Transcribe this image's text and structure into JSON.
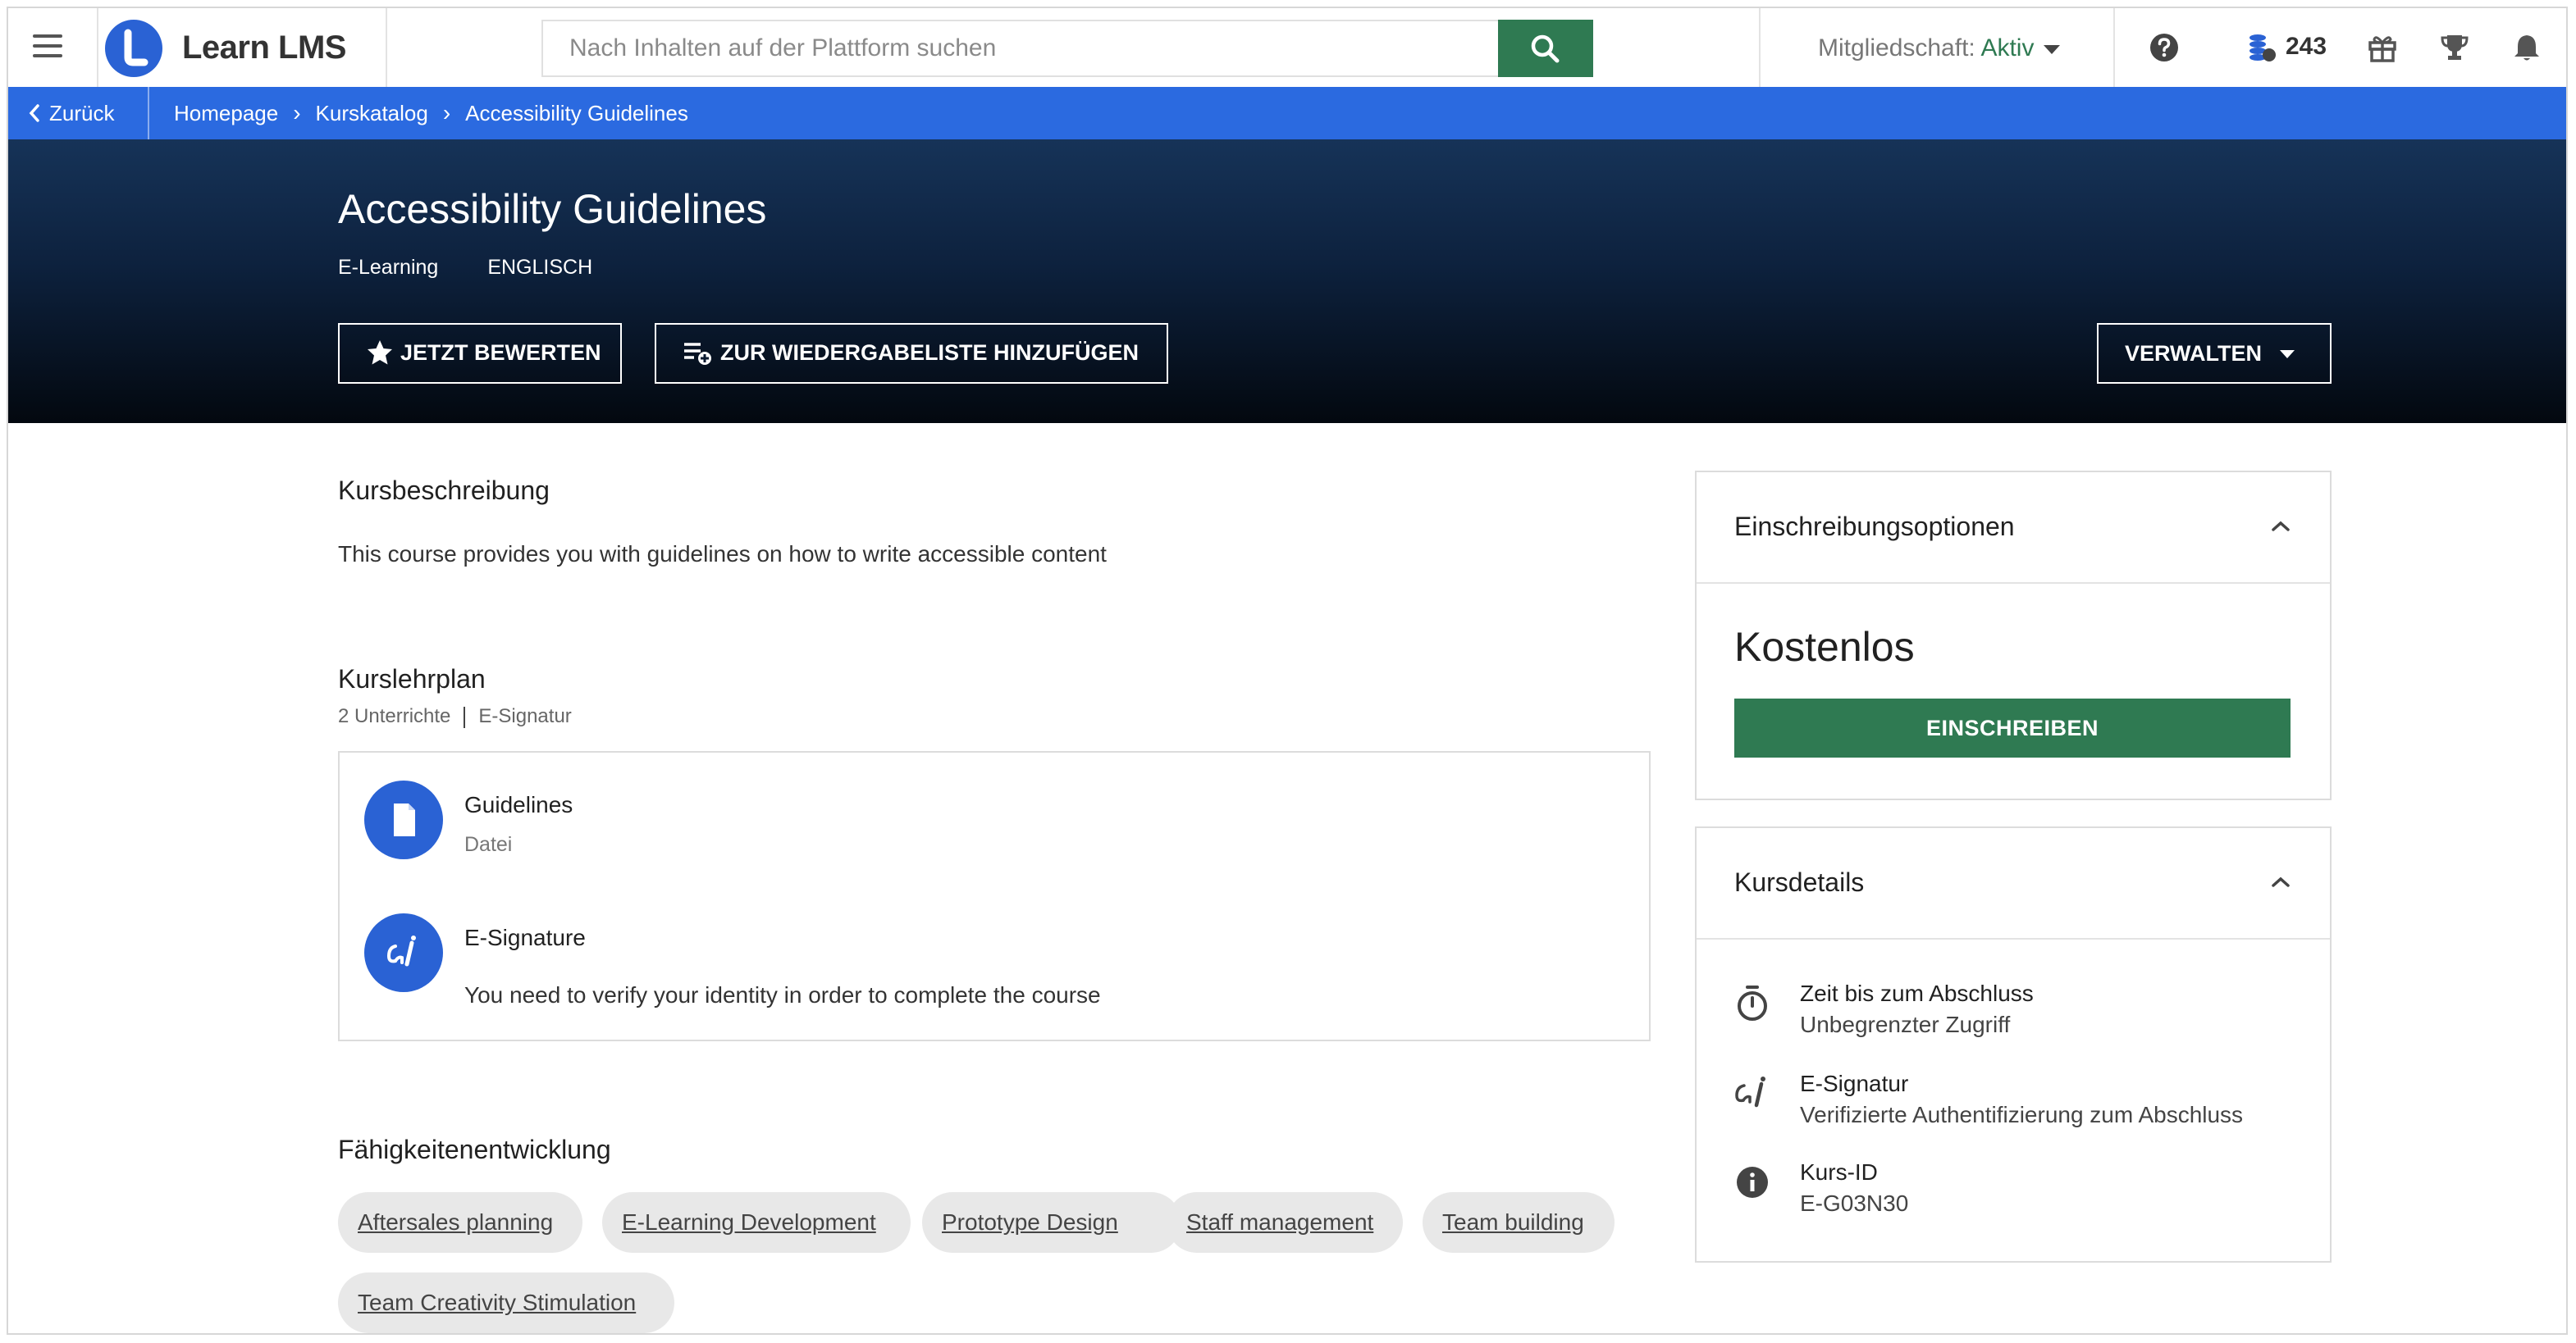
{
  "header": {
    "logo_text": "Learn LMS",
    "search_placeholder": "Nach Inhalten auf der Plattform suchen",
    "membership_label": "Mitgliedschaft:",
    "membership_status": "Aktiv",
    "coins_count": "243",
    "icons": [
      "menu-icon",
      "search-icon",
      "help-icon",
      "coins-icon",
      "gift-icon",
      "trophy-icon",
      "bell-icon"
    ],
    "accent_color": "#2f7a52"
  },
  "breadcrumb": {
    "back_label": "Zurück",
    "items": [
      "Homepage",
      "Kurskatalog",
      "Accessibility Guidelines"
    ],
    "bar_color": "#2b6ae0"
  },
  "course": {
    "title": "Accessibility Guidelines",
    "type": "E-Learning",
    "language": "ENGLISCH",
    "rate_button": "JETZT BEWERTEN",
    "playlist_button": "ZUR WIEDERGABELISTE HINZUFÜGEN",
    "manage_button": "VERWALTEN"
  },
  "description": {
    "heading": "Kursbeschreibung",
    "text": "This course provides you with guidelines on how to write accessible content"
  },
  "curriculum": {
    "heading": "Kurslehrplan",
    "lessons_count": "2 Unterrichte",
    "tag": "E-Signatur",
    "items": [
      {
        "title": "Guidelines",
        "subtitle": "Datei",
        "icon": "file-icon"
      },
      {
        "title": "E-Signature",
        "subtitle": "You need to verify your identity in order to complete the course",
        "icon": "signature-icon"
      }
    ]
  },
  "skills": {
    "heading": "Fähigkeitenentwicklung",
    "tags": [
      "Aftersales planning",
      "E-Learning Development",
      "Prototype Design",
      "Staff management",
      "Team building",
      "Team Creativity Stimulation"
    ]
  },
  "enrollment": {
    "heading": "Einschreibungsoptionen",
    "price": "Kostenlos",
    "enroll_button": "EINSCHREIBEN"
  },
  "details": {
    "heading": "Kursdetails",
    "rows": [
      {
        "label": "Zeit bis zum Abschluss",
        "value": "Unbegrenzter Zugriff",
        "icon": "timer-icon"
      },
      {
        "label": "E-Signatur",
        "value": "Verifizierte Authentifizierung zum Abschluss",
        "icon": "signature-icon"
      },
      {
        "label": "Kurs-ID",
        "value": "E-G03N30",
        "icon": "info-icon"
      }
    ]
  }
}
